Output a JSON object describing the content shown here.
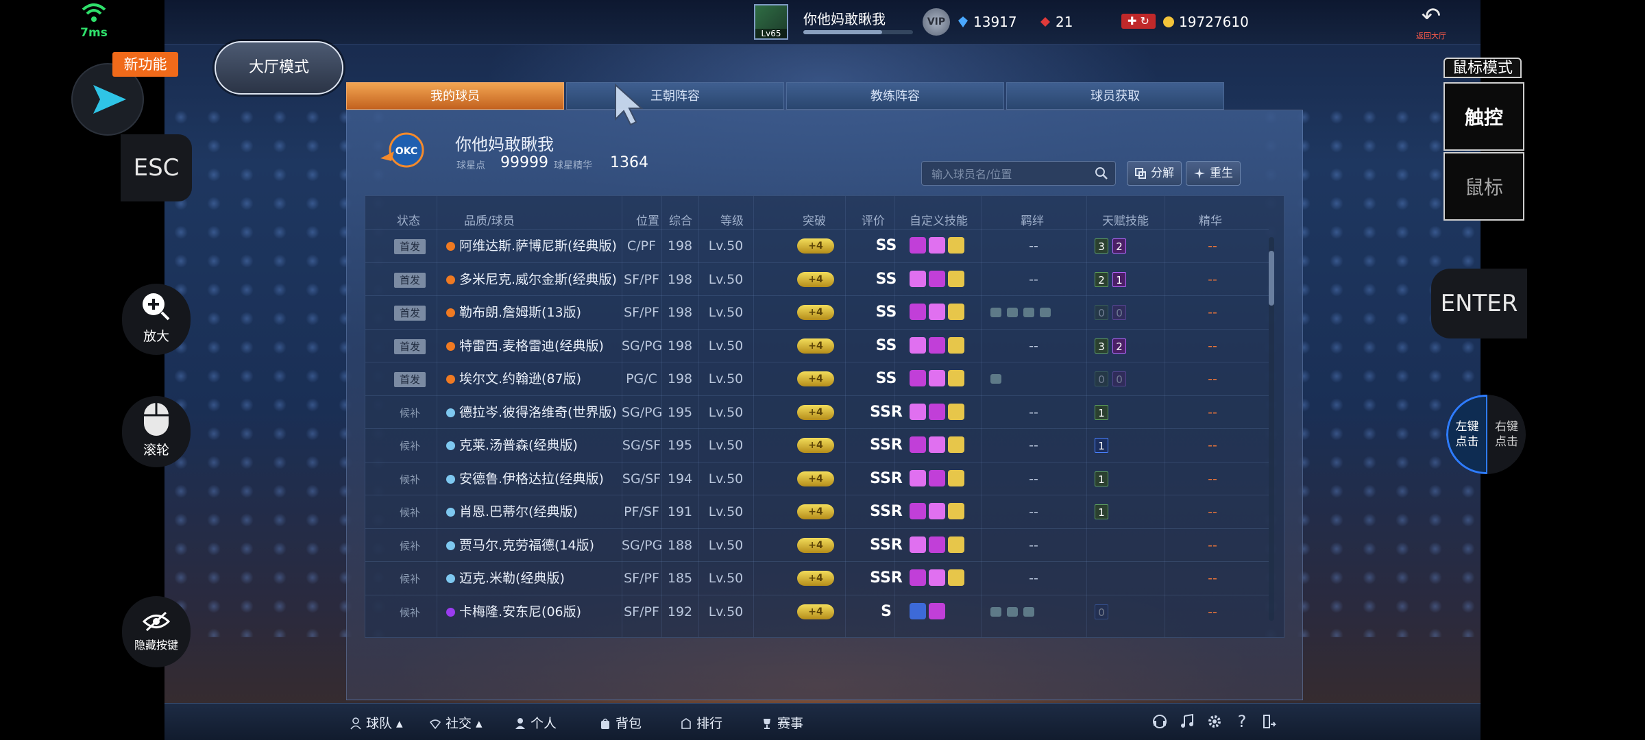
{
  "topbar": {
    "player_name": "你他妈敢瞅我",
    "level": "Lv65",
    "xp_fraction": 0.72,
    "vip_label": "VIP",
    "diamonds": "13917",
    "tickets": "21",
    "gold": "19727610",
    "back_label": "返回大厅"
  },
  "tabs": [
    "我的球员",
    "王朝阵容",
    "教练阵容",
    "球员获取"
  ],
  "team": {
    "name": "你他妈敢瞅我",
    "points_label": "球星点",
    "points": "99999",
    "essence_label": "球星精华",
    "essence": "1364"
  },
  "search": {
    "placeholder": "输入球员名/位置"
  },
  "actions": {
    "decompose": "分解",
    "rebirth": "重生"
  },
  "table": {
    "headers": [
      "状态",
      "品质/球员",
      "位置",
      "综合",
      "等级",
      "突破",
      "评价",
      "自定义技能",
      "羁绊",
      "天赋技能",
      "精华"
    ],
    "rows": [
      {
        "status": "首发",
        "name": "阿维达斯.萨博尼斯(经典版)",
        "pos": "C/PF",
        "ovr": "198",
        "level": "Lv.50",
        "brk": "+4",
        "grade": "SS",
        "talents": [
          "3",
          "2"
        ],
        "essence": "--"
      },
      {
        "status": "首发",
        "name": "多米尼克.威尔金斯(经典版)",
        "pos": "SF/PF",
        "ovr": "198",
        "level": "Lv.50",
        "brk": "+4",
        "grade": "SS",
        "talents": [
          "2",
          "1"
        ],
        "essence": "--"
      },
      {
        "status": "首发",
        "name": "勒布朗.詹姆斯(13版)",
        "pos": "SF/PF",
        "ovr": "198",
        "level": "Lv.50",
        "brk": "+4",
        "grade": "SS",
        "talents": [
          "0",
          "0"
        ],
        "essence": "--"
      },
      {
        "status": "首发",
        "name": "特雷西.麦格雷迪(经典版)",
        "pos": "SG/PG",
        "ovr": "198",
        "level": "Lv.50",
        "brk": "+4",
        "grade": "SS",
        "talents": [
          "3",
          "2"
        ],
        "essence": "--"
      },
      {
        "status": "首发",
        "name": "埃尔文.约翰逊(87版)",
        "pos": "PG/C",
        "ovr": "198",
        "level": "Lv.50",
        "brk": "+4",
        "grade": "SS",
        "talents": [
          "0",
          "0"
        ],
        "essence": "--"
      },
      {
        "status": "候补",
        "name": "德拉岑.彼得洛维奇(世界版)",
        "pos": "SG/PG",
        "ovr": "195",
        "level": "Lv.50",
        "brk": "+4",
        "grade": "SSR",
        "talents": [
          "1"
        ],
        "essence": "--"
      },
      {
        "status": "候补",
        "name": "克莱.汤普森(经典版)",
        "pos": "SG/SF",
        "ovr": "195",
        "level": "Lv.50",
        "brk": "+4",
        "grade": "SSR",
        "talents": [
          "1"
        ],
        "essence": "--"
      },
      {
        "status": "候补",
        "name": "安德鲁.伊格达拉(经典版)",
        "pos": "SG/SF",
        "ovr": "194",
        "level": "Lv.50",
        "brk": "+4",
        "grade": "SSR",
        "talents": [
          "1"
        ],
        "essence": "--"
      },
      {
        "status": "候补",
        "name": "肖恩.巴蒂尔(经典版)",
        "pos": "PF/SF",
        "ovr": "191",
        "level": "Lv.50",
        "brk": "+4",
        "grade": "SSR",
        "talents": [
          "1"
        ],
        "essence": "--"
      },
      {
        "status": "候补",
        "name": "贾马尔.克劳福德(14版)",
        "pos": "SG/PG",
        "ovr": "188",
        "level": "Lv.50",
        "brk": "+4",
        "grade": "SSR",
        "talents": [],
        "essence": "--"
      },
      {
        "status": "候补",
        "name": "迈克.米勒(经典版)",
        "pos": "SF/PF",
        "ovr": "185",
        "level": "Lv.50",
        "brk": "+4",
        "grade": "SSR",
        "talents": [],
        "essence": "--"
      },
      {
        "status": "候补",
        "name": "卡梅隆.安东尼(06版)",
        "pos": "SF/PF",
        "ovr": "192",
        "level": "Lv.50",
        "brk": "+4",
        "grade": "S",
        "talents": [
          "0"
        ],
        "essence": "--"
      }
    ],
    "bond_placeholder": "--"
  },
  "bottom_nav": [
    "球队",
    "社交",
    "个人",
    "背包",
    "排行",
    "赛事"
  ],
  "overlay": {
    "latency": "7ms",
    "new_feature": "新功能",
    "lobby_mode": "大厅模式",
    "esc": "ESC",
    "zoom": "放大",
    "wheel": "滚轮",
    "hide_keys": "隐藏按键",
    "mouse_mode_title": "鼠标模式",
    "touch": "触控",
    "mouse": "鼠标",
    "enter": "ENTER",
    "left_click": "左键\n点击",
    "right_click": "右键\n点击"
  },
  "colors": {
    "accent_tab": "#e58a3a",
    "gold_badge": "#d8b52a",
    "quality_orange": "#f07a22",
    "quality_cyan": "#7ec8f0",
    "quality_purple": "#9a3cf0",
    "latency_green": "#2fe06b"
  }
}
